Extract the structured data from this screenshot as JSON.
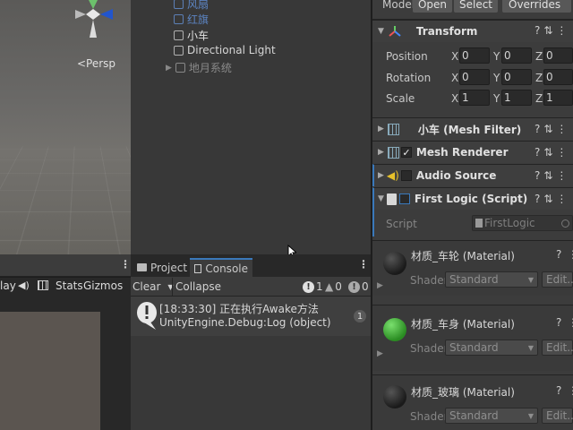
{
  "scene": {
    "persp_label": "<Persp"
  },
  "hierarchy": {
    "items": [
      {
        "label": "风扇",
        "dim": true
      },
      {
        "label": "红旗",
        "dim": true
      },
      {
        "label": "小车",
        "dim": false
      },
      {
        "label": "Directional Light",
        "dim": false
      },
      {
        "label": "地月系统",
        "dim": true
      }
    ]
  },
  "game_toolbar": {
    "play_fragment": "lay",
    "stats": "Stats",
    "gizmos": "Gizmos"
  },
  "console": {
    "tabs": [
      {
        "label": "Project"
      },
      {
        "label": "Console"
      }
    ],
    "toolbar": {
      "clear": "Clear",
      "collapse": "Collapse",
      "count_log": "1",
      "count_warn": "0",
      "count_err": "0"
    },
    "log": {
      "line1": "[18:33:30] 正在执行Awake方法",
      "line2": "UnityEngine.Debug:Log (object)",
      "count": "1"
    }
  },
  "inspector": {
    "header": {
      "model": "Model",
      "open": "Open",
      "select": "Select",
      "overrides": "Overrides"
    },
    "transform": {
      "title": "Transform",
      "rows": [
        {
          "label": "Position",
          "x": "0",
          "y": "0",
          "z": "0"
        },
        {
          "label": "Rotation",
          "x": "0",
          "y": "0",
          "z": "0"
        },
        {
          "label": "Scale",
          "x": "1",
          "y": "1",
          "z": "1"
        }
      ],
      "axis_x": "X",
      "axis_y": "Y",
      "axis_z": "Z"
    },
    "components": [
      {
        "title": "小车 (Mesh Filter)"
      },
      {
        "title": "Mesh Renderer"
      },
      {
        "title": "Audio Source"
      },
      {
        "title": "First Logic (Script)"
      }
    ],
    "script_field": {
      "label": "Script",
      "value": "FirstLogic"
    },
    "materials": [
      {
        "title": "材质_车轮 (Material)",
        "shader_label": "Shader",
        "shader": "Standard",
        "edit": "Edit...",
        "color": "#1f1f1f"
      },
      {
        "title": "材质_车身 (Material)",
        "shader_label": "Shader",
        "shader": "Standard",
        "edit": "Edit...",
        "color": "#3aa832"
      },
      {
        "title": "材质_玻璃 (Material)",
        "shader_label": "Shader",
        "shader": "Standard",
        "edit": "Edit...",
        "color": "#1f1f1f"
      }
    ]
  },
  "colors": {
    "accent": "#3a79bb",
    "panel": "#383838"
  }
}
